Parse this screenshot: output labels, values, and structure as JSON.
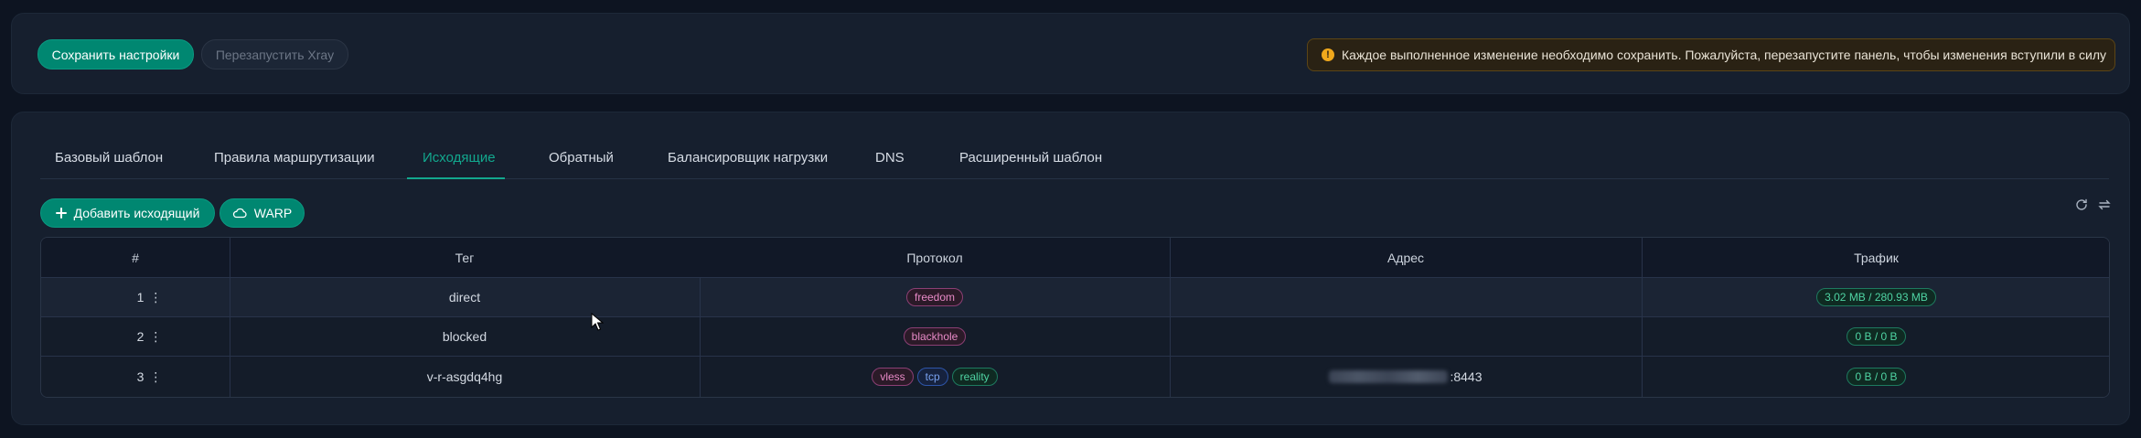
{
  "toolbar": {
    "save_label": "Сохранить настройки",
    "restart_label": "Перезапустить Xray"
  },
  "alert": {
    "icon": "exclamation-icon",
    "text": "Каждое выполненное изменение необходимо сохранить. Пожалуйста, перезапустите панель, чтобы изменения вступили в силу"
  },
  "tabs": [
    {
      "label": "Базовый шаблон",
      "active": false
    },
    {
      "label": "Правила маршрутизации",
      "active": false
    },
    {
      "label": "Исходящие",
      "active": true
    },
    {
      "label": "Обратный",
      "active": false
    },
    {
      "label": "Балансировщик нагрузки",
      "active": false
    },
    {
      "label": "DNS",
      "active": false
    },
    {
      "label": "Расширенный шаблон",
      "active": false
    }
  ],
  "actions": {
    "add_label": "Добавить исходящий",
    "warp_label": "WARP"
  },
  "table": {
    "headers": {
      "num": "#",
      "tag": "Тег",
      "protocol": "Протокол",
      "address": "Адрес",
      "traffic": "Трафик"
    },
    "rows": [
      {
        "num": "1",
        "tag": "direct",
        "protocols": [
          "freedom"
        ],
        "address": "",
        "traffic": "3.02 MB / 280.93 MB"
      },
      {
        "num": "2",
        "tag": "blocked",
        "protocols": [
          "blackhole"
        ],
        "address": "",
        "traffic": "0 B / 0 B"
      },
      {
        "num": "3",
        "tag": "v-r-asgdq4hg",
        "protocols": [
          "vless",
          "tcp",
          "reality"
        ],
        "address": ":8443",
        "traffic": "0 B / 0 B"
      }
    ]
  },
  "colors": {
    "accent": "#008771",
    "background": "#0d1421",
    "card": "#161f2e",
    "warning": "#f0a81c"
  }
}
